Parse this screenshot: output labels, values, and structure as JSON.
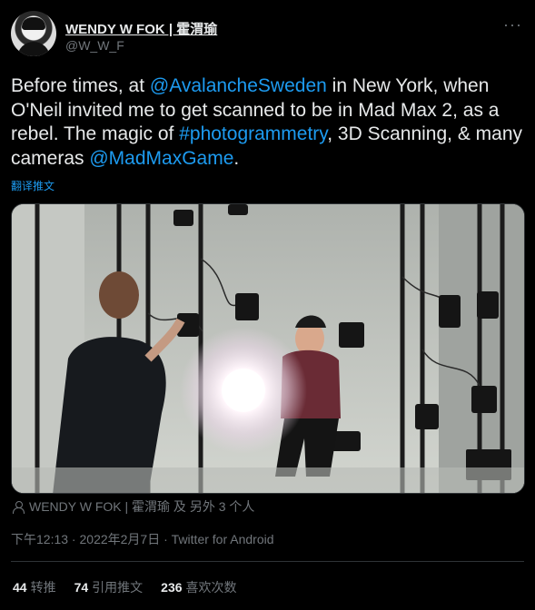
{
  "author": {
    "display_name": "WENDY W FOK | 霍渭瑜",
    "handle": "@W_W_F",
    "more_icon": "more-horizontal-icon"
  },
  "tweet": {
    "segments": [
      {
        "text": "Before times, at ",
        "link": false
      },
      {
        "text": "@AvalancheSweden",
        "link": true
      },
      {
        "text": " in New York, when O'Neil invited me to get scanned to be in Mad Max 2, as a rebel. The magic of ",
        "link": false
      },
      {
        "text": "#photogrammetry",
        "link": true
      },
      {
        "text": ", 3D Scanning, & many cameras ",
        "link": false
      },
      {
        "text": "@MadMaxGame",
        "link": true
      },
      {
        "text": ".",
        "link": false
      }
    ],
    "translate_label": "翻译推文"
  },
  "tagged": {
    "icon": "person-icon",
    "text": "WENDY W FOK | 霍渭瑜 及 另外 3 个人"
  },
  "meta": {
    "time": "下午12:13",
    "separator": " · ",
    "date": "2022年2月7日",
    "source": "Twitter for Android"
  },
  "stats": {
    "retweets_count": "44",
    "retweets_label": "转推",
    "quotes_count": "74",
    "quotes_label": "引用推文",
    "likes_count": "236",
    "likes_label": "喜欢次数"
  },
  "colors": {
    "background": "#000000",
    "text": "#e7e9ea",
    "secondary": "#71767b",
    "link": "#1d9bf0",
    "border": "#2f3336"
  }
}
